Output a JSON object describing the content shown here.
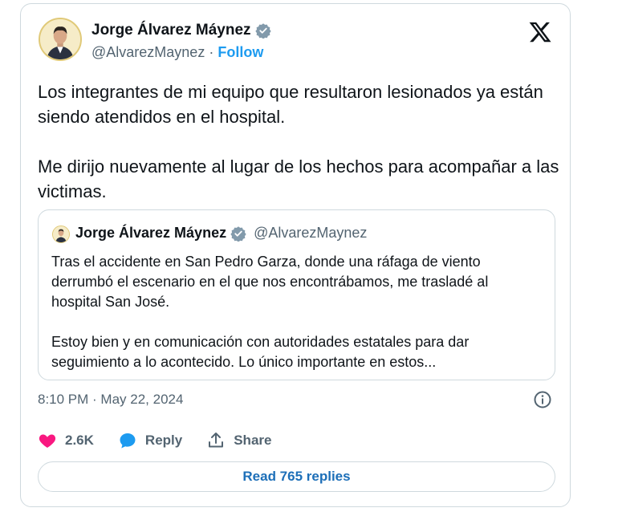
{
  "author": {
    "name": "Jorge Álvarez Máynez",
    "handle": "@AlvarezMaynez",
    "separator": "·",
    "follow_label": "Follow"
  },
  "tweet": {
    "paragraphs": [
      "Los integrantes de mi equipo que resultaron lesionados ya están siendo atendidos en el hospital.",
      "Me dirijo nuevamente al lugar de los hechos para acompañar a las victimas."
    ]
  },
  "quoted_tweet": {
    "name": "Jorge Álvarez Máynez",
    "handle": "@AlvarezMaynez",
    "paragraphs": [
      "Tras el accidente en San Pedro Garza, donde una ráfaga de viento derrumbó el escenario en el que nos encontrábamos, me trasladé al hospital San José.",
      "Estoy bien y en comunicación con autoridades estatales para dar seguimiento a lo acontecido. Lo único importante en estos..."
    ]
  },
  "timestamp": "8:10 PM · May 22, 2024",
  "actions": {
    "like_count": "2.6K",
    "reply_label": "Reply",
    "share_label": "Share"
  },
  "read_replies_label": "Read 765 replies",
  "icons": {
    "verified": "verified-badge-icon",
    "platform": "x-logo-icon",
    "info": "info-icon",
    "like": "heart-icon",
    "reply": "reply-bubble-icon",
    "share": "share-upload-icon"
  },
  "colors": {
    "accent": "#1d9bf0",
    "like": "#f91880",
    "text": "#0f1419",
    "secondary_text": "#536471",
    "border": "#cfd9de"
  }
}
